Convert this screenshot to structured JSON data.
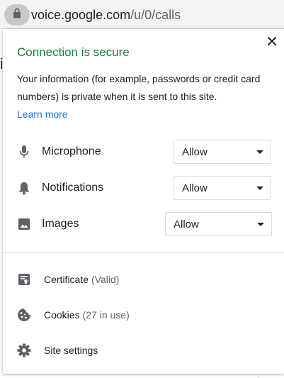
{
  "omnibox": {
    "host": "voice.google.com",
    "path": "/u/0/calls"
  },
  "bubble": {
    "title": "Connection is secure",
    "description": "Your information (for example, passwords or credit card numbers) is private when it is sent to this site.",
    "learn_more": "Learn more",
    "close_icon": "close-icon",
    "colors": {
      "secure_green": "#188038",
      "link_blue": "#1a73e8",
      "icon_gray": "#5f6368",
      "divider": "#dadce0"
    },
    "permissions": [
      {
        "label": "Microphone",
        "icon": "microphone-icon",
        "value": "Allow"
      },
      {
        "label": "Notifications",
        "icon": "bell-icon",
        "value": "Allow"
      },
      {
        "label": "Images",
        "icon": "image-icon",
        "value": "Allow"
      }
    ],
    "links": [
      {
        "label": "Certificate",
        "sub": "(Valid)",
        "icon": "certificate-icon"
      },
      {
        "label": "Cookies",
        "sub": "(27 in use)",
        "icon": "cookie-icon"
      },
      {
        "label": "Site settings",
        "sub": "",
        "icon": "gear-icon"
      }
    ]
  }
}
